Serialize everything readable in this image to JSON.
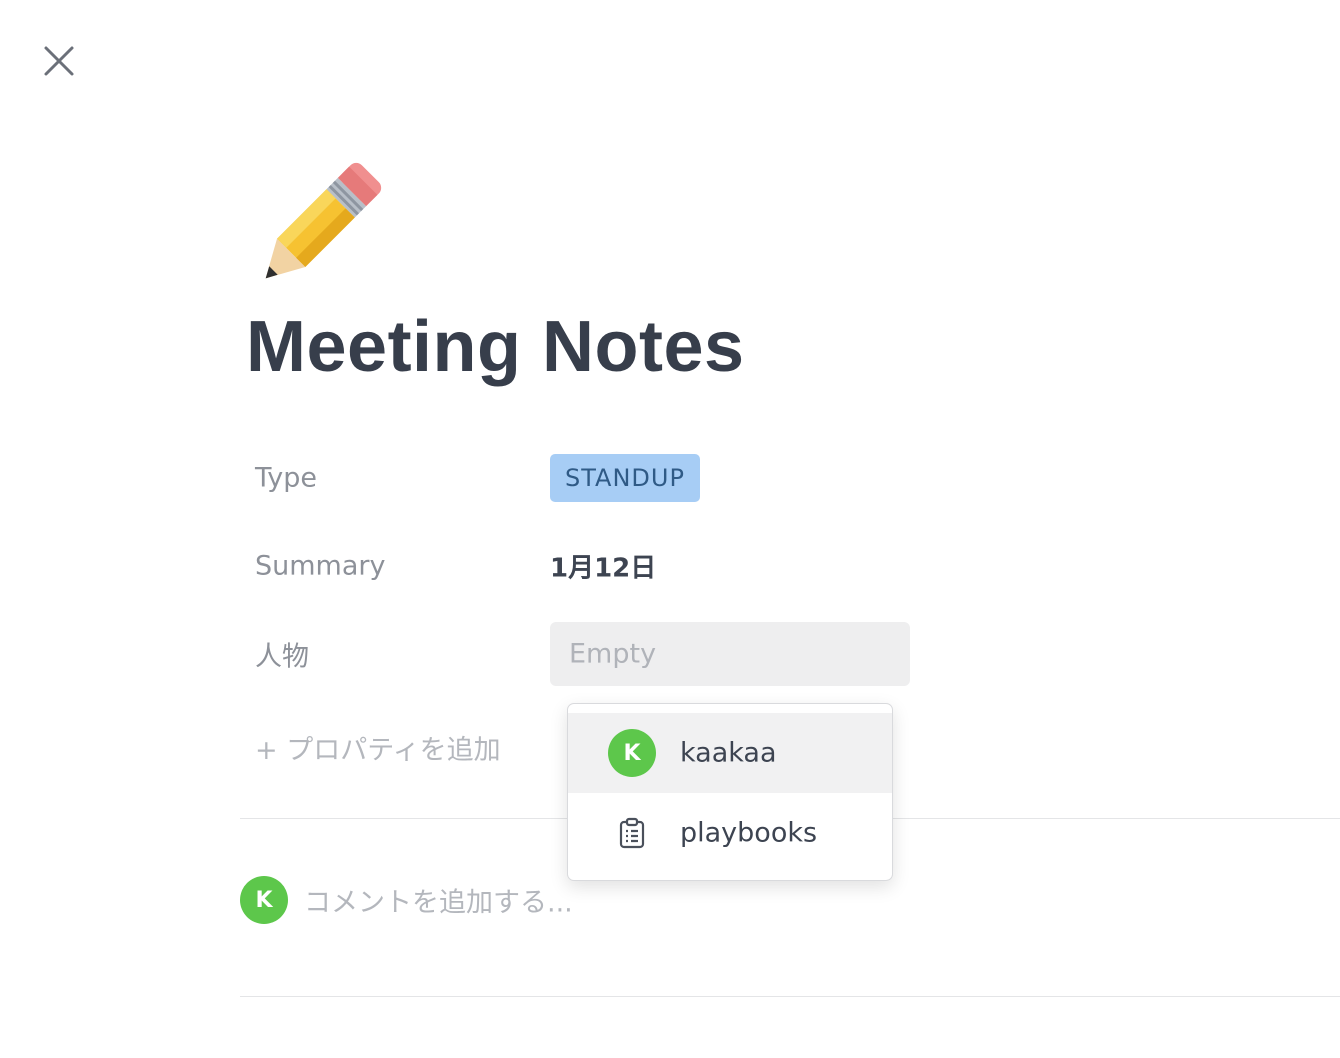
{
  "title": "Meeting Notes",
  "page_icon": "pencil-emoji",
  "close_icon": "close-icon",
  "properties": {
    "type": {
      "label": "Type",
      "value": "STANDUP"
    },
    "summary": {
      "label": "Summary",
      "value": "1月12日"
    },
    "person": {
      "label": "人物",
      "placeholder": "Empty"
    }
  },
  "add_property_label": "+ プロパティを追加",
  "dropdown": {
    "items": [
      {
        "label": "kaakaa",
        "avatar_initial": "K",
        "selected": true
      },
      {
        "label": "playbooks",
        "icon": "clipboard-icon",
        "selected": false
      }
    ]
  },
  "comment": {
    "avatar_initial": "K",
    "placeholder": "コメントを追加する..."
  },
  "colors": {
    "badge_bg": "#a7cdf5",
    "avatar_green": "#5dc74b",
    "title_color": "#373e4b"
  }
}
